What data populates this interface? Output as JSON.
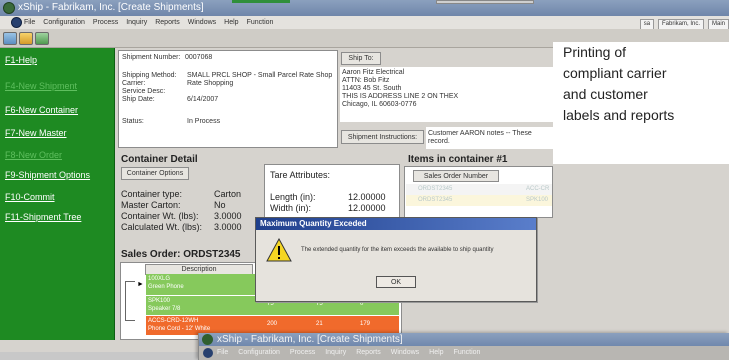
{
  "window": {
    "title": "xShip - Fabrikam, Inc. [Create Shipments]",
    "menu": [
      "File",
      "Configuration",
      "Process",
      "Inquiry",
      "Reports",
      "Windows",
      "Help",
      "Function"
    ],
    "user_badges": [
      "sa",
      "Fabrikam, Inc.",
      "Main"
    ]
  },
  "sidebar": {
    "items": [
      {
        "label": "F1-Help",
        "enabled": true
      },
      {
        "label": "F4-New Shipment",
        "enabled": false
      },
      {
        "label": "F6-New Container",
        "enabled": true
      },
      {
        "label": "F7-New Master",
        "enabled": true
      },
      {
        "label": "F8-New Order",
        "enabled": false
      },
      {
        "label": "F9-Shipment Options",
        "enabled": true
      },
      {
        "label": "F10-Commit",
        "enabled": true
      },
      {
        "label": "F11-Shipment Tree",
        "enabled": true
      }
    ]
  },
  "shipment": {
    "number_label": "Shipment Number:",
    "number_value": "0007068",
    "method_label": "Shipping Method:",
    "method_value": "SMALL PRCL SHOP - Small Parcel Rate Shop",
    "carrier_label": "Carrier:",
    "carrier_value": "Rate Shopping",
    "service_label": "Service Desc:",
    "shipdate_label": "Ship Date:",
    "shipdate_value": "6/14/2007",
    "status_label": "Status:",
    "status_value": "In Process"
  },
  "ship_to": {
    "button": "Ship To:",
    "lines": [
      "Aaron Fitz Electrical",
      "ATTN: Bob Fitz",
      "11403 45 St. South",
      "THIS IS ADDRESS LINE 2 ON THEX",
      "Chicago, IL  60603-0776"
    ]
  },
  "instructions": {
    "button": "Shipment Instructions:",
    "text_line1": "Customer AARON notes -- These",
    "text_line2": "record."
  },
  "container": {
    "title": "Container Detail",
    "options_button": "Container Options",
    "type_label": "Container type:",
    "type_value": "Carton",
    "master_label": "Master Carton:",
    "master_value": "No",
    "weight_label": "Container Wt. (lbs):",
    "weight_value": "3.0000",
    "calc_label": "Calculated Wt. (lbs):",
    "calc_value": "3.0000",
    "tare_label": "Tare Attributes:",
    "length_label": "Length (in):",
    "length_value": "12.00000",
    "width_label": "Width (in):",
    "width_value": "12.00000"
  },
  "items": {
    "title": "Items in container #1",
    "column": "Sales Order Number",
    "rows": [
      {
        "order": "ORDST2345",
        "item": "ACC-CR"
      },
      {
        "order": "ORDST2345",
        "item": "SPK100"
      }
    ]
  },
  "sales_order": {
    "title": "Sales Order: ORDST2345",
    "column": "Description",
    "rows": [
      {
        "item": "100XLG",
        "desc": "Green Phone",
        "q1": "",
        "q2": "",
        "q3": "",
        "color": "#86c95c"
      },
      {
        "item": "SPK100",
        "desc": "Speaker 7/8",
        "q1": "75",
        "q2": "75",
        "q3": "0",
        "color": "#86c95c"
      },
      {
        "item": "ACCS-CRD-12WH",
        "desc": "Phone Cord - 12' White",
        "q1": "200",
        "q2": "21",
        "q3": "179",
        "color": "#f06a2c"
      }
    ]
  },
  "dialog": {
    "title": "Maximum Quantity Exceded",
    "message": "The extended quantity for the item exceeds the available to ship quantity",
    "ok": "OK"
  },
  "caption": {
    "lines": [
      "Printing of",
      "compliant carrier",
      "and customer",
      "labels and reports"
    ]
  },
  "second_window": {
    "title": "xShip - Fabrikam, Inc. [Create Shipments]",
    "menu": [
      "File",
      "Configuration",
      "Process",
      "Inquiry",
      "Reports",
      "Windows",
      "Help",
      "Function"
    ]
  }
}
